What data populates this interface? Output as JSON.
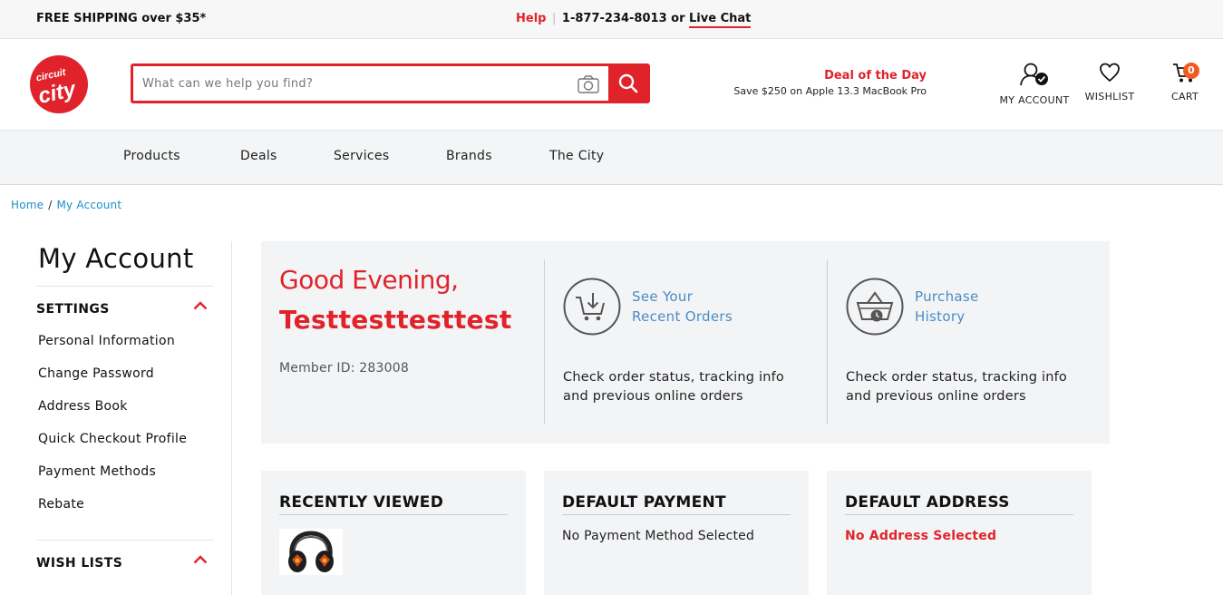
{
  "topbar": {
    "shipping": "FREE SHIPPING over $35*",
    "help": "Help",
    "separator": "|",
    "phone": "1-877-234-8013 or",
    "live_chat": "Live Chat"
  },
  "header": {
    "logo_text_top": "circuit",
    "logo_text_main": "city",
    "search": {
      "placeholder": "What can we help you find?",
      "value": ""
    },
    "deal_title": "Deal of the Day",
    "deal_subtitle": "Save $250 on Apple 13.3 MacBook Pro",
    "account_label": "MY ACCOUNT",
    "wishlist_label": "WISHLIST",
    "cart_label": "CART",
    "cart_count": "0"
  },
  "nav": {
    "items": [
      "Products",
      "Deals",
      "Services",
      "Brands",
      "The City"
    ]
  },
  "breadcrumb": {
    "home": "Home",
    "separator": "/",
    "current": "My Account"
  },
  "sidebar": {
    "title": "My Account",
    "settings_label": "SETTINGS",
    "links": [
      "Personal Information",
      "Change Password",
      "Address Book",
      "Quick Checkout Profile",
      "Payment Methods",
      "Rebate"
    ],
    "wishlists_label": "WISH LISTS"
  },
  "greeting": {
    "salutation": "Good Evening,",
    "name": "Testtesttesttest",
    "member_id": "Member ID: 283008"
  },
  "tiles": [
    {
      "line1": "See Your",
      "line2": "Recent Orders",
      "desc": "Check order status, tracking info and previous online orders",
      "icon": "shopping-cart-icon"
    },
    {
      "line1": "Purchase",
      "line2": "History",
      "desc": "Check order status, tracking info and previous online orders",
      "icon": "basket-clock-icon"
    }
  ],
  "cards": {
    "recent": {
      "title": "RECENTLY VIEWED"
    },
    "payment": {
      "title": "DEFAULT PAYMENT",
      "text": "No Payment Method Selected"
    },
    "address": {
      "title": "DEFAULT ADDRESS",
      "text": "No Address Selected"
    }
  },
  "colors": {
    "brand_red": "#e0232b",
    "link_blue": "#4a8cc4",
    "badge_orange": "#f25a1f"
  }
}
